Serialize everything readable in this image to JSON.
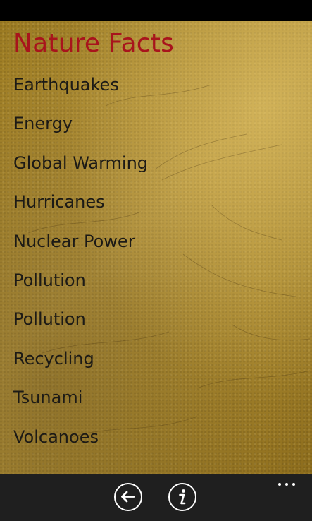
{
  "colors": {
    "title": "#a8141c",
    "list_text": "#1c1a16",
    "background": "#a8872c",
    "app_bar": "#1f1f1f"
  },
  "page": {
    "title": "Nature Facts"
  },
  "topics": [
    "Earthquakes",
    "Energy",
    "Global Warming",
    "Hurricanes",
    "Nuclear Power",
    "Pollution",
    "Pollution",
    "Recycling",
    "Tsunami",
    "Volcanoes"
  ],
  "app_bar": {
    "buttons": [
      {
        "icon": "back-arrow-icon"
      },
      {
        "icon": "info-icon"
      }
    ],
    "more_icon": "ellipsis-icon"
  }
}
